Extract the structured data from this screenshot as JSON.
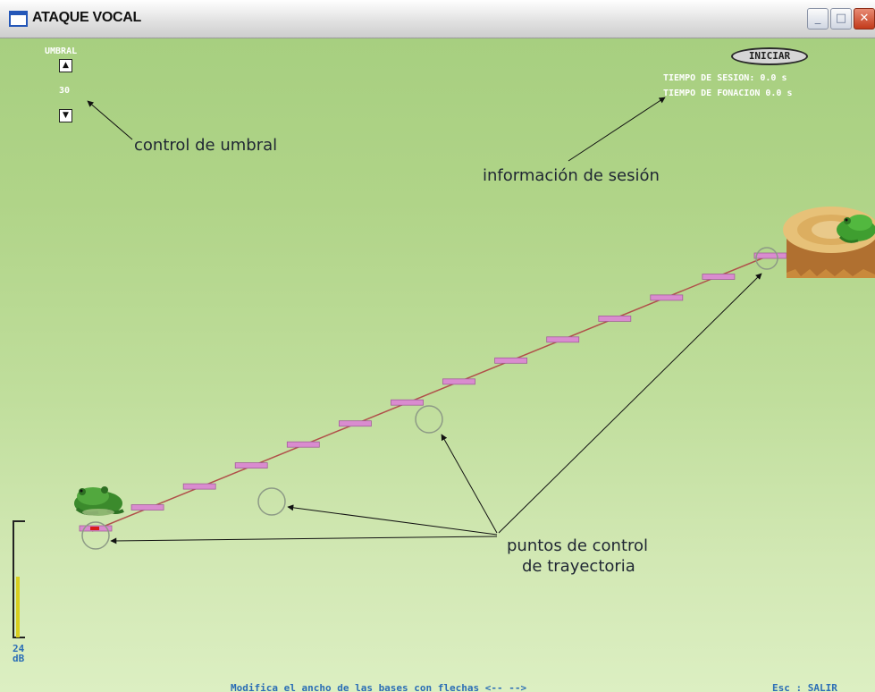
{
  "window": {
    "title": "ATAQUE VOCAL",
    "buttons": [
      "minimize",
      "maximize",
      "close"
    ]
  },
  "threshold": {
    "label": "UMBRAL",
    "value": "30",
    "up_icon": "triangle-up-icon",
    "down_icon": "triangle-down-icon"
  },
  "session": {
    "start_label": "INICIAR",
    "session_time": "TIEMPO DE SESION: 0.0 s",
    "phonation_time": "TIEMPO DE FONACION 0.0 s"
  },
  "annotations": {
    "threshold_control": "control de umbral",
    "session_info": "información de sesión",
    "control_points_line1": "puntos de control",
    "control_points_line2": "de trayectoria"
  },
  "meter": {
    "value": "24",
    "unit": "dB",
    "colors": {
      "bar": "#d8cf20",
      "bracket": "#222222"
    }
  },
  "footer": {
    "hint": "Modifica el ancho de las bases con flechas <-- -->",
    "exit": "Esc : SALIR"
  },
  "steps": {
    "count": 14,
    "color": "#d98ccf",
    "path_color": "#b0504a"
  },
  "characters": {
    "start": "frog-icon",
    "goal": "frog-on-log-icon"
  },
  "colors": {
    "background_top": "#a7cf80",
    "background_bottom": "#dcefc2",
    "text_light": "#ffffff",
    "footer_text": "#2b6eb6"
  }
}
